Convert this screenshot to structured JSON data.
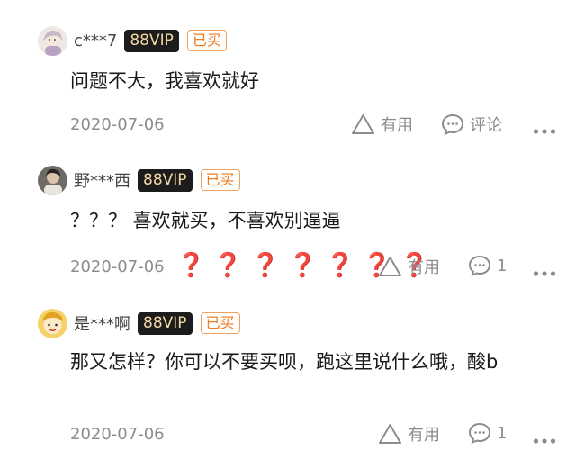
{
  "comments": [
    {
      "username": "c***7",
      "vip": "88VIP",
      "bought": "已买",
      "content": "问题不大，我喜欢就好",
      "date": "2020-07-06",
      "useful_label": "有用",
      "reply_label": "评论",
      "avatar_icon": "anime-girl-avatar"
    },
    {
      "username": "野***西",
      "vip": "88VIP",
      "bought": "已买",
      "content": "？？？ 喜欢就买，不喜欢别逼逼",
      "date": "2020-07-06",
      "stickers": "❓❓❓❓❓❓❓",
      "useful_label": "有用",
      "reply_count": "1",
      "avatar_icon": "person-photo-avatar"
    },
    {
      "username": "是***啊",
      "vip": "88VIP",
      "bought": "已买",
      "content": "那又怎样？你可以不要买呗，跑这里说什么哦，酸b",
      "date": "2020-07-06",
      "useful_label": "有用",
      "reply_count": "1",
      "avatar_icon": "cartoon-avatar"
    }
  ],
  "colors": {
    "vip_bg": "#1c1c1c",
    "vip_text": "#f2d7a4",
    "bought_border": "#f0a25d",
    "bought_text": "#f07b21",
    "sticker": "#e0223a",
    "meta": "#8c8c8c"
  }
}
